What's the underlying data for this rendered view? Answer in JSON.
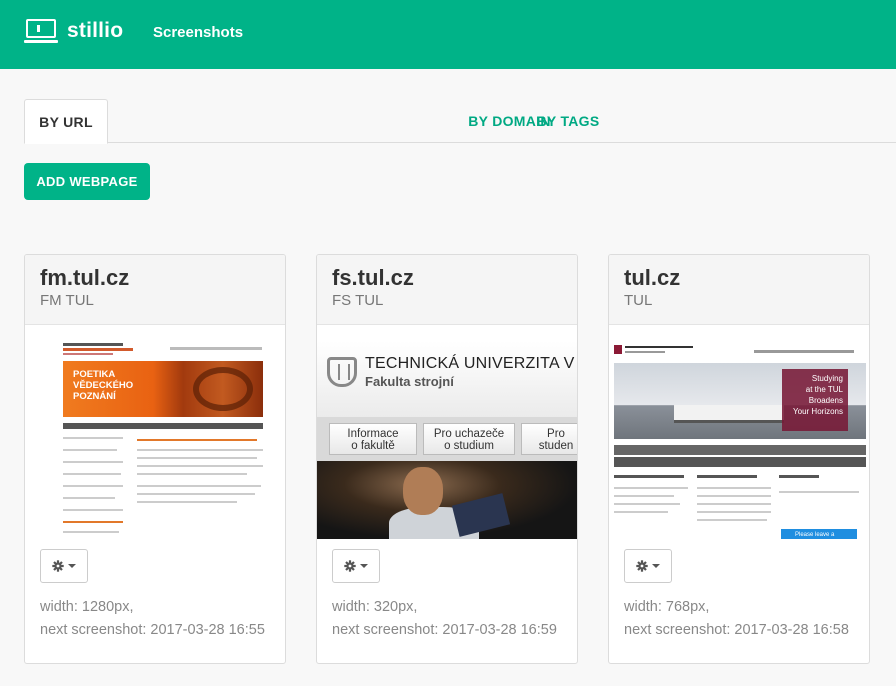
{
  "app": {
    "brand": "stillio",
    "nav_link": "Screenshots"
  },
  "colors": {
    "accent": "#00b388",
    "tab_text": "#00a983"
  },
  "tabs": [
    {
      "label": "BY URL",
      "active": true
    },
    {
      "label": "BY DOMAIN",
      "active": false
    },
    {
      "label": "BY TAGS",
      "active": false
    }
  ],
  "add_button": "ADD WEBPAGE",
  "cards": [
    {
      "title": "fm.tul.cz",
      "subtitle": "FM TUL",
      "width": "width: 1280px,",
      "next": "next screenshot: 2017-03-28 16:55",
      "thumb": {
        "banner_line1": "POETIKA",
        "banner_line2": "VĚDECKÉHO",
        "banner_line3": "POZNÁNÍ"
      }
    },
    {
      "title": "fs.tul.cz",
      "subtitle": "FS TUL",
      "width": "width: 320px,",
      "next": "next screenshot: 2017-03-28 16:59",
      "thumb": {
        "name1": "TECHNICKÁ UNIVERZITA V LIBER",
        "name2": "Fakulta strojní",
        "btn1a": "Informace",
        "btn1b": "o fakultě",
        "btn2a": "Pro uchazeče",
        "btn2b": "o studium",
        "btn3a": "Pro",
        "btn3b": "studen"
      }
    },
    {
      "title": "tul.cz",
      "subtitle": "TUL",
      "width": "width: 768px,",
      "next": "next screenshot: 2017-03-28 16:58",
      "thumb": {
        "hero_line1": "Studying",
        "hero_line2": "at the TUL",
        "hero_line3": "Broadens",
        "hero_line4": "Your Horizons",
        "chat": "Please leave a message"
      }
    }
  ],
  "icons": {
    "logo": "laptop-icon",
    "settings": "gear-icon",
    "dropdown": "caret-down-icon"
  }
}
